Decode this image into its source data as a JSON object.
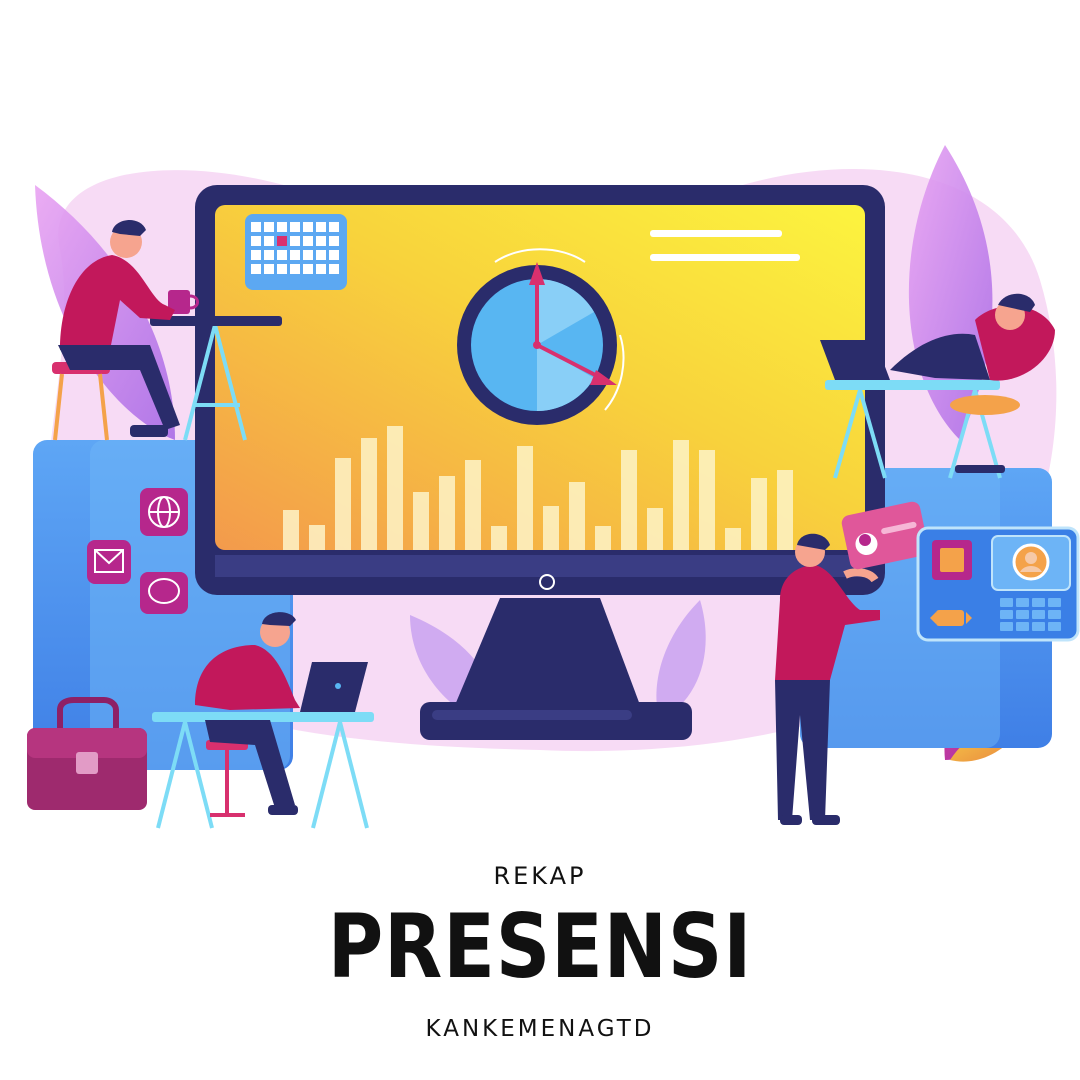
{
  "poster": {
    "kicker": "REKAP",
    "headline": "PRESENSI",
    "tagline": "KANKEMENAGTD"
  },
  "illustration": {
    "subject": "office workers around a large monitor showing a clock and bar chart",
    "icons": [
      "calendar-icon",
      "clock-icon",
      "globe-icon",
      "mail-icon",
      "chat-icon",
      "briefcase-icon",
      "id-card-icon",
      "user-avatar-icon",
      "laptop-icon",
      "coffee-cup-icon"
    ],
    "colors": {
      "screen_yellow": "#FBEA3C",
      "screen_orange": "#F4A24A",
      "monitor_frame": "#2A2C6B",
      "panel_blue": "#4A8CF0",
      "panel_light": "#6FB3F5",
      "accent_magenta": "#C2185B",
      "leaf_purple": "#C58BF0",
      "blob_pink": "#F6D2F2",
      "clock_blue": "#59B6F2"
    }
  }
}
